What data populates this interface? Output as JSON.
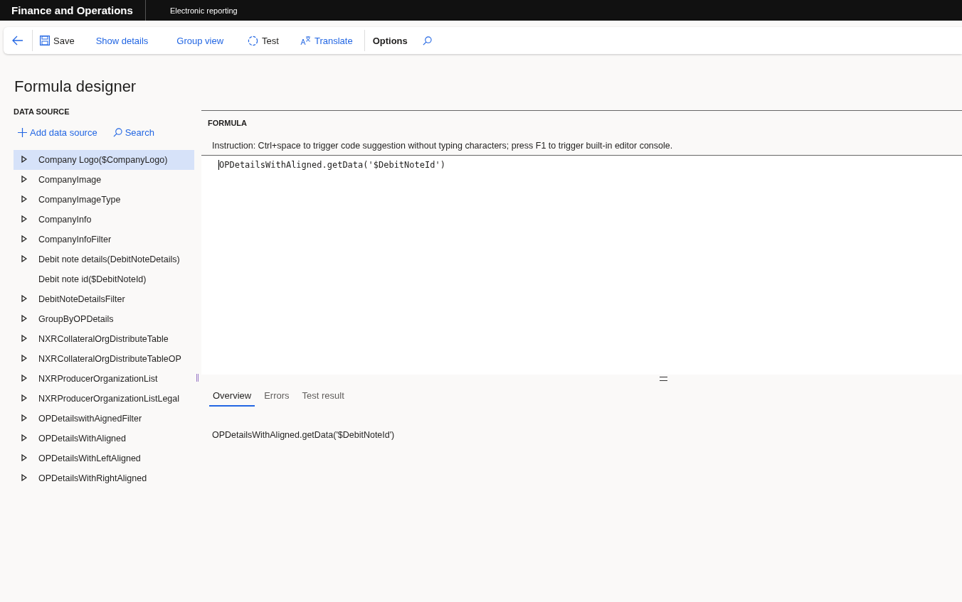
{
  "header": {
    "app_title": "Finance and Operations",
    "module": "Electronic reporting"
  },
  "toolbar": [
    {
      "kind": "back"
    },
    {
      "kind": "save",
      "label": "Save"
    },
    {
      "kind": "link",
      "label": "Show details"
    },
    {
      "kind": "link",
      "label": "Group view"
    },
    {
      "kind": "test",
      "label": "Test"
    },
    {
      "kind": "translate",
      "label": "Translate"
    },
    {
      "kind": "divider"
    },
    {
      "kind": "menu",
      "label": "Options"
    },
    {
      "kind": "search"
    }
  ],
  "page_title": "Formula designer",
  "data_source": {
    "heading": "DATA SOURCE",
    "actions": [
      {
        "kind": "add",
        "label": "Add data source"
      },
      {
        "kind": "search",
        "label": "Search"
      }
    ],
    "items": [
      {
        "label": "Company Logo($CompanyLogo)",
        "expandable": true,
        "selected": true
      },
      {
        "label": "CompanyImage",
        "expandable": true,
        "selected": false
      },
      {
        "label": "CompanyImageType",
        "expandable": true,
        "selected": false
      },
      {
        "label": "CompanyInfo",
        "expandable": true,
        "selected": false
      },
      {
        "label": "CompanyInfoFilter",
        "expandable": true,
        "selected": false
      },
      {
        "label": "Debit note details(DebitNoteDetails)",
        "expandable": true,
        "selected": false
      },
      {
        "label": "Debit note id($DebitNoteId)",
        "expandable": false,
        "selected": false
      },
      {
        "label": "DebitNoteDetailsFilter",
        "expandable": true,
        "selected": false
      },
      {
        "label": "GroupByOPDetails",
        "expandable": true,
        "selected": false
      },
      {
        "label": "NXRCollateralOrgDistributeTable",
        "expandable": true,
        "selected": false
      },
      {
        "label": "NXRCollateralOrgDistributeTableOP",
        "expandable": true,
        "selected": false
      },
      {
        "label": "NXRProducerOrganizationList",
        "expandable": true,
        "selected": false
      },
      {
        "label": "NXRProducerOrganizationListLegal",
        "expandable": true,
        "selected": false
      },
      {
        "label": "OPDetailswithAignedFilter",
        "expandable": true,
        "selected": false
      },
      {
        "label": "OPDetailsWithAligned",
        "expandable": true,
        "selected": false
      },
      {
        "label": "OPDetailsWithLeftAligned",
        "expandable": true,
        "selected": false
      },
      {
        "label": "OPDetailsWithRightAligned",
        "expandable": true,
        "selected": false
      }
    ]
  },
  "formula": {
    "heading": "FORMULA",
    "instruction": "Instruction: Ctrl+space to trigger code suggestion without typing characters; press F1 to trigger built-in editor console.",
    "code": "OPDetailsWithAligned.getData('$DebitNoteId')"
  },
  "result_tabs": [
    {
      "label": "Overview",
      "selected": true
    },
    {
      "label": "Errors",
      "selected": false
    },
    {
      "label": "Test result",
      "selected": false
    }
  ],
  "result_text": "OPDetailsWithAligned.getData('$DebitNoteId')"
}
